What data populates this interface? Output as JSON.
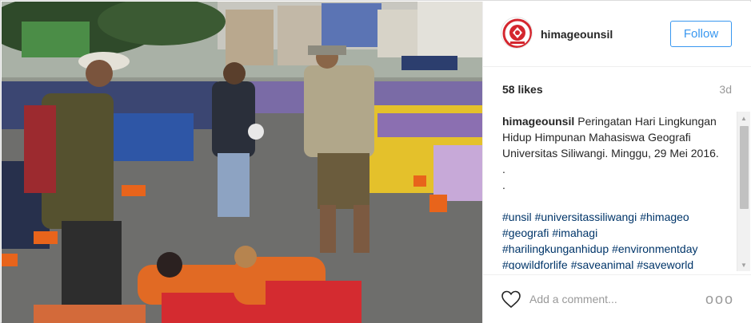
{
  "post": {
    "username": "himageounsil",
    "follow_label": "Follow",
    "likes": "58 likes",
    "age": "3d",
    "caption": {
      "username": "himageounsil",
      "text": "Peringatan Hari Lingkungan Hidup Himpunan Mahasiswa Geografi Universitas Siliwangi. Minggu, 29 Mei 2016.",
      "dots": [
        ".",
        "."
      ],
      "hashtags": [
        "#unsil",
        "#universitassiliwangi",
        "#himageo",
        "#geografi",
        "#imahagi",
        "#harilingkunganhidup",
        "#environmentday",
        "#gowildforlife",
        "#saveanimal",
        "#saveworld"
      ]
    },
    "comment_placeholder": "Add a comment...",
    "more_label": "ooo"
  },
  "icons": {
    "avatar": "himageo-logo",
    "like": "heart-outline-icon",
    "more": "more-options-icon"
  },
  "colors": {
    "link_blue": "#3897f0",
    "hashtag": "#003569",
    "logo_red": "#d4262e"
  }
}
